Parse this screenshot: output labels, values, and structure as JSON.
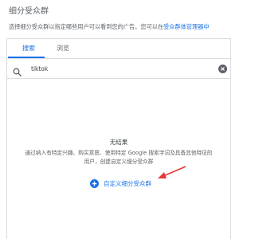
{
  "section": {
    "title": "细分受众群",
    "description_prefix": "选择细分受众群以指定哪些用户可以看到您的广告。您可以在",
    "description_link": "受众群体管理器中"
  },
  "tabs": [
    {
      "label": "搜索",
      "active": true
    },
    {
      "label": "浏览",
      "active": false
    }
  ],
  "search": {
    "value": "tiktok",
    "icon": "search-icon",
    "clear_icon": "clear-icon"
  },
  "results": {
    "empty_title": "无结果",
    "hint": "通过纳入有特定兴趣、购买意愿、使用特定 Google 搜索字词及具备其他特征的用户，创建自定义细分受众群",
    "create_label": "自定义细分受众群",
    "create_icon": "plus-icon"
  },
  "colors": {
    "accent": "#1a73e8",
    "annotation_arrow": "#e53935",
    "border": "#dadce0"
  }
}
